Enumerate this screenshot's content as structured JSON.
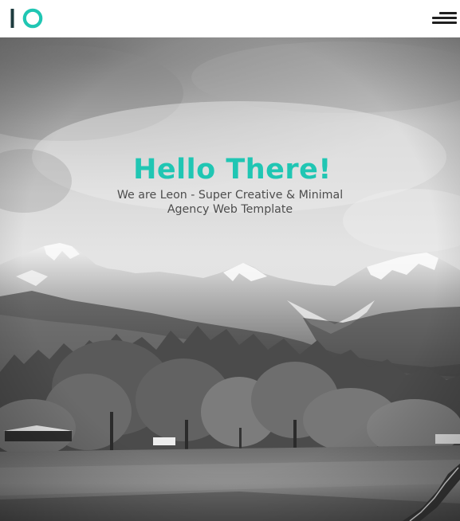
{
  "header": {
    "logo_icon": "leon-logo-icon",
    "menu_icon": "hamburger-menu-icon"
  },
  "hero": {
    "title": "Hello There!",
    "subtitle": "We are Leon - Super Creative & Minimal Agency Web Template",
    "background": "mountain-landscape-image"
  },
  "colors": {
    "accent": "#20c6b3",
    "logo_bar": "#1d3b3e",
    "text_muted": "#4d4d4d"
  }
}
